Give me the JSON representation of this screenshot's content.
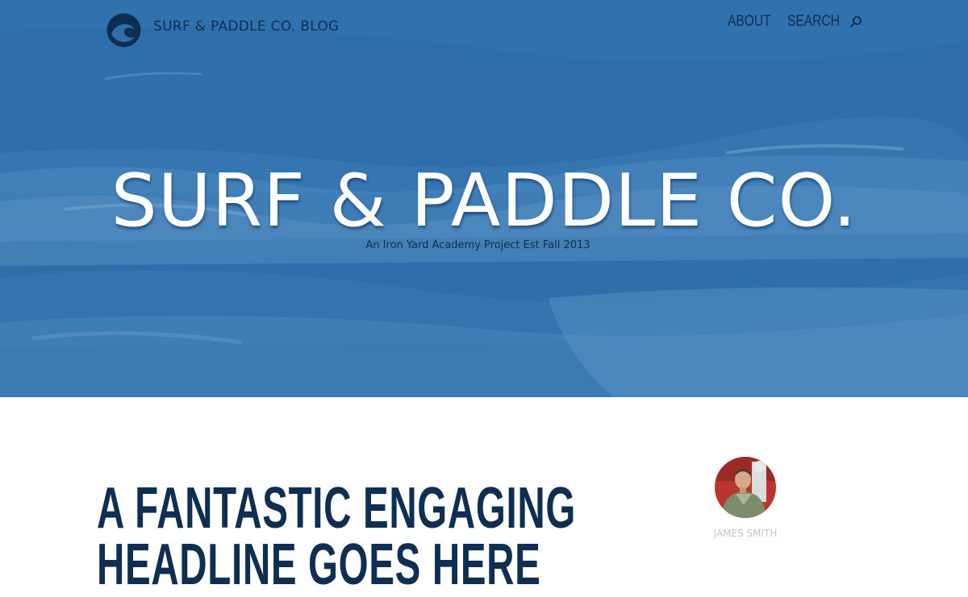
{
  "header": {
    "blog_title": "SURF & PADDLE CO. BLOG",
    "logo_icon": "wave-logo-icon"
  },
  "nav": {
    "about_label": "ABOUT",
    "search_label": "SEARCH",
    "search_icon": "search-icon"
  },
  "hero": {
    "title": "SURF & PADDLE CO.",
    "tagline": "An Iron Yard Academy Project Est Fall 2013",
    "overlay_color": "#2e6fab"
  },
  "post": {
    "headline_line1": "A FANTASTIC ENGAGING",
    "headline_line2": "HEADLINE GOES HERE"
  },
  "author": {
    "name": "JAMES SMITH"
  },
  "colors": {
    "navy": "#0f2f52",
    "hero_blue": "#2e6fab",
    "white": "#ffffff"
  }
}
